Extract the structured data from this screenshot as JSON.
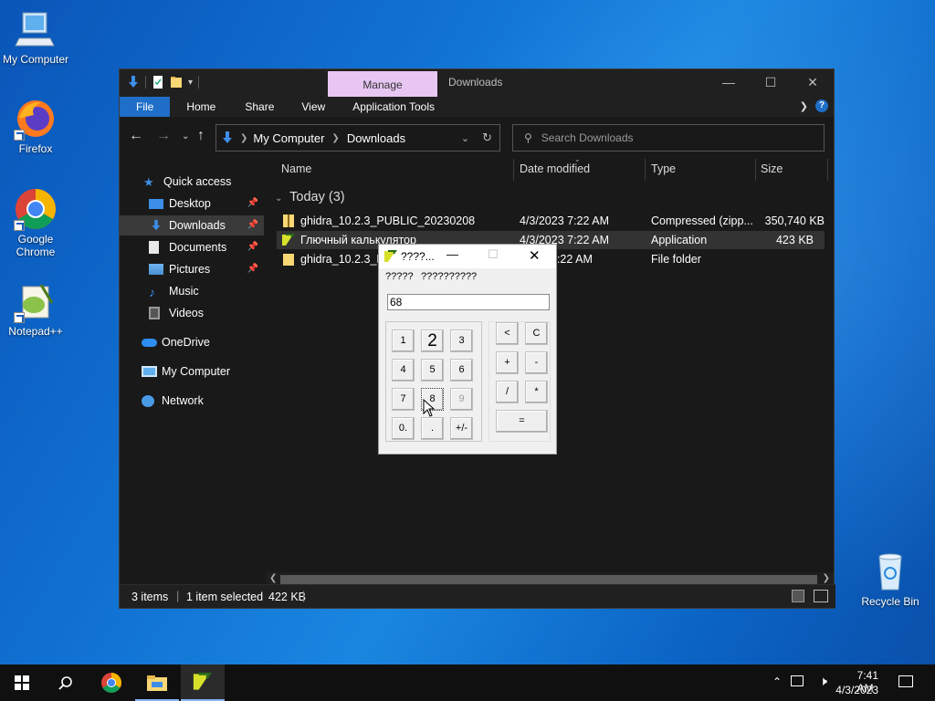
{
  "desktop": {
    "icons": [
      {
        "label": "My Computer"
      },
      {
        "label": "Firefox"
      },
      {
        "label": "Google Chrome"
      },
      {
        "label": "Notepad++"
      },
      {
        "label": "Recycle Bin"
      }
    ]
  },
  "explorer": {
    "contextual_tab": "Manage",
    "title": "Downloads",
    "ribbon_tabs": [
      "File",
      "Home",
      "Share",
      "View",
      "Application Tools"
    ],
    "breadcrumb": [
      "My Computer",
      "Downloads"
    ],
    "search_placeholder": "Search Downloads",
    "nav": {
      "quick_access": "Quick access",
      "items": [
        {
          "label": "Desktop",
          "pinned": true
        },
        {
          "label": "Downloads",
          "pinned": true,
          "selected": true
        },
        {
          "label": "Documents",
          "pinned": true
        },
        {
          "label": "Pictures",
          "pinned": true
        },
        {
          "label": "Music",
          "pinned": false
        },
        {
          "label": "Videos",
          "pinned": false
        }
      ],
      "onedrive": "OneDrive",
      "my_computer": "My Computer",
      "network": "Network"
    },
    "columns": [
      "Name",
      "Date modified",
      "Type",
      "Size"
    ],
    "group": "Today (3)",
    "files": [
      {
        "name": "ghidra_10.2.3_PUBLIC_20230208",
        "date": "4/3/2023 7:22 AM",
        "type": "Compressed (zipp...",
        "size": "350,740 KB"
      },
      {
        "name": "Глючный калькулятор",
        "date": "4/3/2023 7:22 AM",
        "type": "Application",
        "size": "423 KB"
      },
      {
        "name": "ghidra_10.2.3_PU",
        "date": "7:22 AM",
        "type": "File folder",
        "size": ""
      }
    ],
    "status": {
      "items": "3 items",
      "selected": "1 item selected",
      "size": "422 KB"
    }
  },
  "calculator": {
    "title": "????...",
    "menu": [
      "?????",
      "??????????"
    ],
    "display": "68",
    "digit_keys": [
      "1",
      "2",
      "3",
      "4",
      "5",
      "6",
      "7",
      "8",
      "9",
      "0.",
      ".",
      "+/-"
    ],
    "op_keys": [
      "<",
      "C",
      "+",
      "-",
      "/",
      "*",
      "="
    ]
  },
  "taskbar": {
    "time": "7:41 AM",
    "date": "4/3/2023"
  },
  "colors": {
    "accent": "#1f6ec7",
    "manage_tab": "#e7c6f2"
  }
}
